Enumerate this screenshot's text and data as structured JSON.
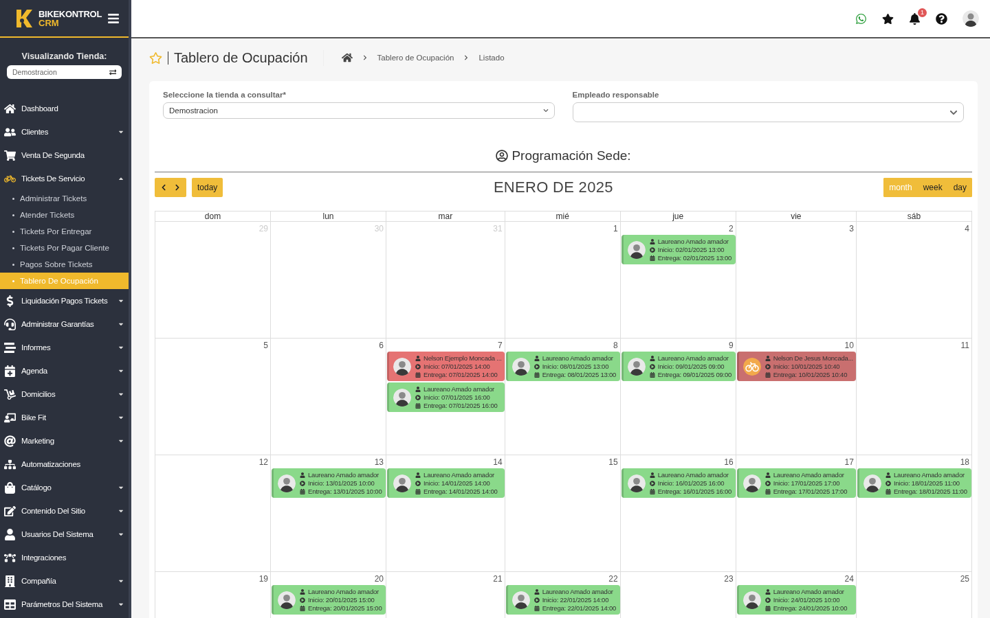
{
  "brand": {
    "name": "BIKEKONTROL",
    "sub": "CRM"
  },
  "store_picker": {
    "label": "Visualizando Tienda:",
    "value": "Demostracion"
  },
  "sidebar": {
    "items": [
      {
        "label": "Dashboard",
        "expandable": false,
        "expanded": false
      },
      {
        "label": "Clientes",
        "expandable": true,
        "expanded": false
      },
      {
        "label": "Venta De Segunda",
        "expandable": false,
        "expanded": false
      },
      {
        "label": "Tickets De Servicio",
        "expandable": true,
        "expanded": true,
        "children": [
          {
            "label": "Administrar Tickets",
            "selected": false
          },
          {
            "label": "Atender Tickets",
            "selected": false
          },
          {
            "label": "Tickets Por Entregar",
            "selected": false
          },
          {
            "label": "Tickets Por Pagar Cliente",
            "selected": false
          },
          {
            "label": "Pagos Sobre Tickets",
            "selected": false
          },
          {
            "label": "Tablero De Ocupación",
            "selected": true
          }
        ]
      },
      {
        "label": "Liquidación Pagos Tickets",
        "expandable": true,
        "expanded": false
      },
      {
        "label": "Administrar Garantías",
        "expandable": true,
        "expanded": false
      },
      {
        "label": "Informes",
        "expandable": true,
        "expanded": false
      },
      {
        "label": "Agenda",
        "expandable": true,
        "expanded": false
      },
      {
        "label": "Domicilios",
        "expandable": true,
        "expanded": false
      },
      {
        "label": "Bike Fit",
        "expandable": true,
        "expanded": false
      },
      {
        "label": "Marketing",
        "expandable": true,
        "expanded": false
      },
      {
        "label": "Automatizaciones",
        "expandable": false,
        "expanded": false
      },
      {
        "label": "Catálogo",
        "expandable": true,
        "expanded": false
      },
      {
        "label": "Contenido Del Sitio",
        "expandable": true,
        "expanded": false
      },
      {
        "label": "Usuarios Del Sistema",
        "expandable": true,
        "expanded": false
      },
      {
        "label": "Integraciones",
        "expandable": false,
        "expanded": false
      },
      {
        "label": "Compañía",
        "expandable": true,
        "expanded": false
      },
      {
        "label": "Parámetros Del Sistema",
        "expandable": true,
        "expanded": false
      }
    ]
  },
  "topbar": {
    "notification_count": "1"
  },
  "page": {
    "title": "Tablero de Ocupación",
    "breadcrumb": [
      "Tablero de Ocupación",
      "Listado"
    ]
  },
  "filters": [
    {
      "label": "Seleccione la tienda a consultar*",
      "value": "Demostracion"
    },
    {
      "label": "Empleado responsable"
    }
  ],
  "schedule_heading": "Programación Sede:",
  "calendar": {
    "title": "ENERO DE 2025",
    "today_label": "today",
    "views": [
      {
        "label": "month",
        "selected": true
      },
      {
        "label": "week",
        "selected": false
      },
      {
        "label": "day",
        "selected": false
      }
    ],
    "weekdays": [
      "dom",
      "lun",
      "mar",
      "mié",
      "jue",
      "vie",
      "sáb"
    ],
    "weeks": [
      [
        {
          "day": "29",
          "muted": true
        },
        {
          "day": "30",
          "muted": true
        },
        {
          "day": "31",
          "muted": true
        },
        {
          "day": "1",
          "muted": false
        },
        {
          "day": "2",
          "muted": false,
          "events": [
            {
              "kind": "person",
              "color": "#8ad98a",
              "name": "Laureano Amado amador",
              "start": "Inicio: 02/01/2025 13:00",
              "end": "Entrega: 02/01/2025 13:00"
            }
          ]
        },
        {
          "day": "3",
          "muted": false
        },
        {
          "day": "4",
          "muted": false
        }
      ],
      [
        {
          "day": "5",
          "muted": false
        },
        {
          "day": "6",
          "muted": false
        },
        {
          "day": "7",
          "muted": false,
          "events": [
            {
              "kind": "person",
              "color": "#e57373",
              "name": "Nelson Ejemplo Moncada ...",
              "start": "Inicio: 07/01/2025 14:00",
              "end": "Entrega: 07/01/2025 14:00"
            },
            {
              "kind": "person",
              "color": "#8ad98a",
              "name": "Laureano Amado amador",
              "start": "Inicio: 07/01/2025 16:00",
              "end": "Entrega: 07/01/2025 16:00"
            }
          ]
        },
        {
          "day": "8",
          "muted": false,
          "events": [
            {
              "kind": "person",
              "color": "#8ad98a",
              "name": "Laureano Amado amador",
              "start": "Inicio: 08/01/2025 13:00",
              "end": "Entrega: 08/01/2025 13:00"
            }
          ]
        },
        {
          "day": "9",
          "muted": false,
          "events": [
            {
              "kind": "person",
              "color": "#8ad98a",
              "name": "Laureano Amado amador",
              "start": "Inicio: 09/01/2025 09:00",
              "end": "Entrega: 09/01/2025 09:00"
            }
          ]
        },
        {
          "day": "10",
          "muted": false,
          "events": [
            {
              "kind": "bike",
              "color": "#c96f6f",
              "name": "Nelson De Jesus Moncada...",
              "start": "Inicio: 10/01/2025 10:40",
              "end": "Entrega: 10/01/2025 10:40"
            }
          ]
        },
        {
          "day": "11",
          "muted": false
        }
      ],
      [
        {
          "day": "12",
          "muted": false
        },
        {
          "day": "13",
          "muted": false,
          "events": [
            {
              "kind": "person",
              "color": "#8ad98a",
              "name": "Laureano Amado amador",
              "start": "Inicio: 13/01/2025 10:00",
              "end": "Entrega: 13/01/2025 10:00"
            }
          ]
        },
        {
          "day": "14",
          "muted": false,
          "events": [
            {
              "kind": "person",
              "color": "#8ad98a",
              "name": "Laureano Amado amador",
              "start": "Inicio: 14/01/2025 14:00",
              "end": "Entrega: 14/01/2025 14:00"
            }
          ]
        },
        {
          "day": "15",
          "muted": false
        },
        {
          "day": "16",
          "muted": false,
          "events": [
            {
              "kind": "person",
              "color": "#8ad98a",
              "name": "Laureano Amado amador",
              "start": "Inicio: 16/01/2025 16:00",
              "end": "Entrega: 16/01/2025 16:00"
            }
          ]
        },
        {
          "day": "17",
          "muted": false,
          "events": [
            {
              "kind": "person",
              "color": "#8ad98a",
              "name": "Laureano Amado amador",
              "start": "Inicio: 17/01/2025 17:00",
              "end": "Entrega: 17/01/2025 17:00"
            }
          ]
        },
        {
          "day": "18",
          "muted": false,
          "events": [
            {
              "kind": "person",
              "color": "#8ad98a",
              "name": "Laureano Amado amador",
              "start": "Inicio: 18/01/2025 11:00",
              "end": "Entrega: 18/01/2025 11:00"
            }
          ]
        }
      ],
      [
        {
          "day": "19",
          "muted": false
        },
        {
          "day": "20",
          "muted": false,
          "events": [
            {
              "kind": "person",
              "color": "#8ad98a",
              "name": "Laureano Amado amador",
              "start": "Inicio: 20/01/2025 15:00",
              "end": "Entrega: 20/01/2025 15:00"
            }
          ]
        },
        {
          "day": "21",
          "muted": false
        },
        {
          "day": "22",
          "muted": false,
          "events": [
            {
              "kind": "person",
              "color": "#8ad98a",
              "name": "Laureano Amado amador",
              "start": "Inicio: 22/01/2025 14:00",
              "end": "Entrega: 22/01/2025 14:00"
            }
          ]
        },
        {
          "day": "23",
          "muted": false
        },
        {
          "day": "24",
          "muted": false,
          "events": [
            {
              "kind": "person",
              "color": "#8ad98a",
              "name": "Laureano Amado amador",
              "start": "Inicio: 24/01/2025 10:00",
              "end": "Entrega: 24/01/2025 10:00"
            }
          ]
        },
        {
          "day": "25",
          "muted": false
        }
      ]
    ]
  }
}
